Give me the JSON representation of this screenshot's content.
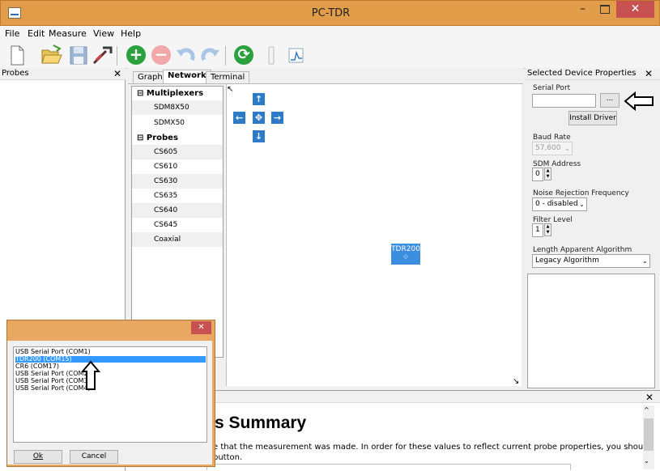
{
  "window": {
    "title": "PC-TDR",
    "minimize": "–",
    "close": "✕"
  },
  "menu": [
    "File",
    "Edit",
    "Measure",
    "View",
    "Help"
  ],
  "toolbar": {
    "icons": [
      "new-file-icon",
      "open-folder-icon",
      "save-icon",
      "probe-icon",
      "add-icon",
      "remove-icon",
      "undo-icon",
      "redo-icon",
      "refresh-icon",
      "battery-icon",
      "waveform-icon"
    ]
  },
  "probes_panel": {
    "title": "Probes",
    "close": "✕"
  },
  "center_panel": {
    "tabs": [
      "Graph",
      "Network",
      "Terminal"
    ],
    "active_tab": "Network",
    "tree": {
      "groups": [
        {
          "label": "Multiplexers",
          "items": [
            "SDM8X50",
            "SDMX50"
          ]
        },
        {
          "label": "Probes",
          "items": [
            "CS605",
            "CS610",
            "CS630",
            "CS635",
            "CS640",
            "CS645",
            "Coaxial"
          ]
        }
      ]
    },
    "node": {
      "label": "TDR200",
      "sub": "◇"
    },
    "nav": {
      "up": "↑",
      "down": "↓",
      "left": "←",
      "right": "→",
      "center": "✥"
    }
  },
  "properties": {
    "title": "Selected Device Properties",
    "close": "✕",
    "serial_port_label": "Serial Port",
    "serial_port_value": "",
    "browse_button": "...",
    "install_driver": "Install Driver",
    "baud_rate_label": "Baud Rate",
    "baud_rate_value": "57,600",
    "sdm_address_label": "SDM Address",
    "sdm_address_value": "0",
    "noise_label": "Noise Rejection Frequency",
    "noise_value": "0 - disabled",
    "filter_label": "Filter Level",
    "filter_value": "1",
    "algorithm_label": "Length Apparent Algorithm",
    "algorithm_value": "Legacy Algorithm"
  },
  "summary": {
    "close": "✕",
    "heading": "s Summary",
    "line1": "e that the measurement was made. In order for these values to reflect current probe properties, you should",
    "line2": "button."
  },
  "dialog": {
    "close": "✕",
    "ports": [
      "USB Serial Port (COM1)",
      "TDR200 (COM15)",
      "CR6 (COM17)",
      "USB Serial Port (COM2)",
      "USB Serial Port (COM3)",
      "USB Serial Port (COM4)"
    ],
    "selected_port": "TDR200 (COM15)",
    "ok": "Ok",
    "cancel": "Cancel"
  },
  "colors": {
    "titlebar": "#e29d4a",
    "accent": "#2d7ac9",
    "selection": "#3399ff",
    "close_button": "#c75050"
  }
}
